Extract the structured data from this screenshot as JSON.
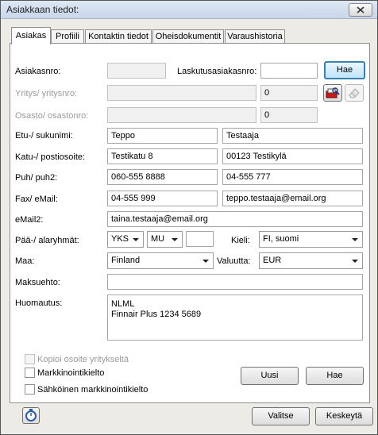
{
  "window": {
    "title": "Asiakkaan tiedot:"
  },
  "tabs": [
    "Asiakas",
    "Profiili",
    "Kontaktin tiedot",
    "Oheisdokumentit",
    "Varaushistoria"
  ],
  "labels": {
    "customer_no": "Asiakasnro:",
    "billing_no": "Laskutusasiakasnro:",
    "company": "Yritys/ yritysnro:",
    "department": "Osasto/ osastonro:",
    "name": "Etu-/ sukunimi:",
    "address": "Katu-/ postiosoite:",
    "phone": "Puh/ puh2:",
    "fax_email": "Fax/ eMail:",
    "email2": "eMail2:",
    "groups": "Pää-/ alaryhmät:",
    "language": "Kieli:",
    "country": "Maa:",
    "currency": "Valuutta:",
    "payment_terms": "Maksuehto:",
    "remarks": "Huomautus:"
  },
  "fields": {
    "customer_no": "",
    "billing_no": "",
    "company_name": "",
    "company_no": "0",
    "department_name": "",
    "department_no": "0",
    "first_name": "Teppo",
    "last_name": "Testaaja",
    "street": "Testikatu 8",
    "postal": "00123 Testikylä",
    "phone": "060-555 8888",
    "phone2": "04-555 777",
    "fax": "04-555 999",
    "email": "teppo.testaaja@email.org",
    "email2": "taina.testaaja@email.org",
    "main_group": "YKS",
    "sub_group": "MU",
    "group_extra": "",
    "language": "FI, suomi",
    "country": "Finland",
    "currency": "EUR",
    "payment_terms": "",
    "remarks_line1": "NLML",
    "remarks_line2": "Finnair Plus 1234 5689"
  },
  "buttons": {
    "search_top": "Hae",
    "new": "Uusi",
    "search": "Hae",
    "select": "Valitse",
    "cancel": "Keskeytä"
  },
  "checkboxes": {
    "copy_company_address": {
      "label": "Kopioi osoite yritykseltä",
      "checked": false,
      "disabled": true
    },
    "marketing_ban": {
      "label": "Markkinointikielto",
      "checked": false
    },
    "email_marketing_ban": {
      "label": "Sähköinen markkinointikielto",
      "checked": false
    }
  },
  "icons": {
    "close": "close-icon",
    "card_search": "card-search-icon",
    "eraser": "eraser-icon",
    "stopwatch": "stopwatch-icon"
  },
  "colors": {
    "default_button_border": "#3c7fb1",
    "titlebar": "#c9d6ea"
  }
}
